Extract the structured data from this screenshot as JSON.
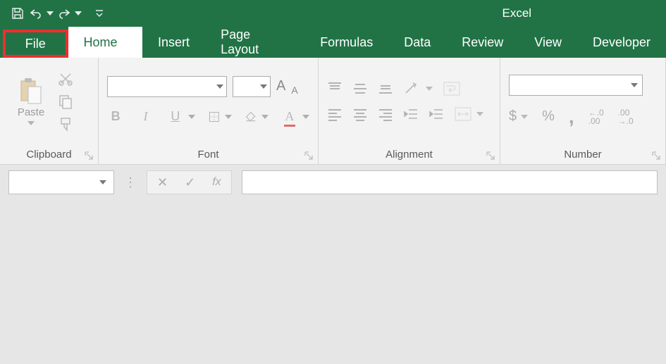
{
  "app": {
    "title": "Excel"
  },
  "tabs": {
    "file": "File",
    "home": "Home",
    "insert": "Insert",
    "pageLayout": "Page Layout",
    "formulas": "Formulas",
    "data": "Data",
    "review": "Review",
    "view": "View",
    "developer": "Developer"
  },
  "ribbon": {
    "clipboard": {
      "label": "Clipboard",
      "paste": "Paste"
    },
    "font": {
      "label": "Font",
      "bold": "B",
      "italic": "I",
      "underline": "U",
      "growA": "A",
      "shrinkA": "A",
      "colorA": "A"
    },
    "alignment": {
      "label": "Alignment"
    },
    "number": {
      "label": "Number",
      "dollar": "$",
      "percent": "%",
      "comma": ",",
      "dec1": ".0",
      "dec1b": "←.0",
      "dec2": ".00",
      "dec2b": "→.0"
    }
  },
  "formulaBar": {
    "fx": "fx",
    "cancel": "✕",
    "confirm": "✓"
  }
}
